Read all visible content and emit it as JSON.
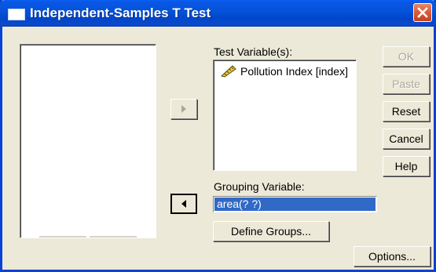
{
  "window": {
    "title": "Independent-Samples T Test",
    "icon": "dialog-window-icon",
    "close_icon": "close-icon",
    "title_color": "#0a57e6",
    "close_color": "#d95a3a"
  },
  "source_list": {
    "items": []
  },
  "test_variables": {
    "label": "Test Variable(s):",
    "items": [
      {
        "icon": "ruler-scale-icon",
        "label": "Pollution Index [index]"
      }
    ]
  },
  "grouping": {
    "label": "Grouping Variable:",
    "value": "area(? ?)",
    "selection_color": "#3169c6"
  },
  "buttons": {
    "ok": "OK",
    "paste": "Paste",
    "reset": "Reset",
    "cancel": "Cancel",
    "help": "Help",
    "define_groups": "Define Groups...",
    "options": "Options..."
  },
  "arrows": {
    "test_var_arrow_icon": "move-right-arrow-icon",
    "grouping_arrow_icon": "move-left-arrow-icon"
  }
}
